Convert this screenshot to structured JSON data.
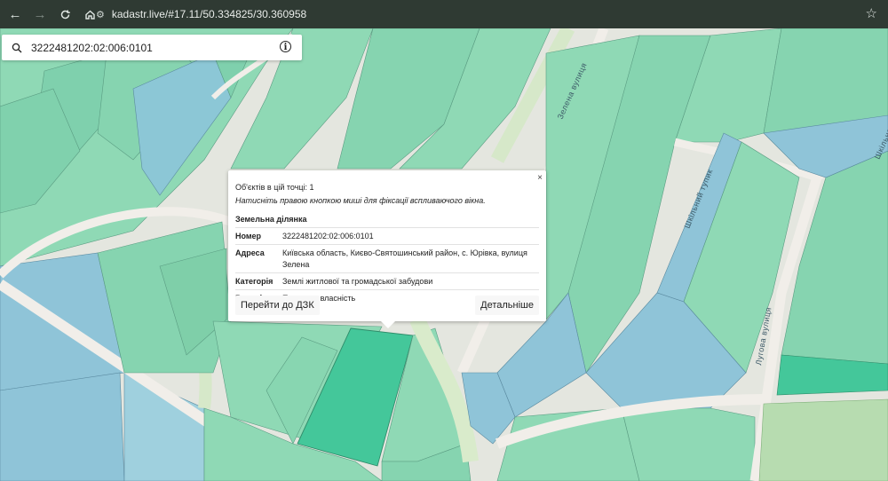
{
  "browser": {
    "url": "kadastr.live/#17.11/50.334825/30.360958",
    "back_icon": "arrow-left-icon",
    "forward_icon": "arrow-right-icon",
    "reload_icon": "reload-icon",
    "home_icon": "home-icon",
    "site_info_icon": "site-settings-icon",
    "bookmark_icon": "star-icon"
  },
  "search": {
    "value": "3222481202:02:006:0101",
    "info_icon": "info-icon"
  },
  "map": {
    "streets": [
      "Зелена вулиця",
      "Шкільний тупик",
      "Лугова вулиця",
      "Шкільна"
    ],
    "colors": {
      "parcel_green": "#8fd9b5",
      "parcel_blue": "#8fc4d8",
      "selected_parcel": "#44c79a",
      "road": "#f1eee9"
    }
  },
  "popup": {
    "close": "×",
    "count": "Об'єктів в цій точці: 1",
    "hint": "Натисніть правою кнопкою миші для фіксації вспливаючого вікна.",
    "section": "Земельна ділянка",
    "rows": [
      {
        "key": "Номер",
        "value": "3222481202:02:006:0101"
      },
      {
        "key": "Адреса",
        "value": "Київська область, Києво-Святошинський район, с. Юрівка, вулиця Зелена"
      },
      {
        "key": "Категорія",
        "value": "Землі житлової та громадської забудови"
      },
      {
        "key": "Власність",
        "value": "Приватна власність"
      }
    ],
    "btn_dzk": "Перейти до ДЗК",
    "btn_details": "Детальніше"
  }
}
